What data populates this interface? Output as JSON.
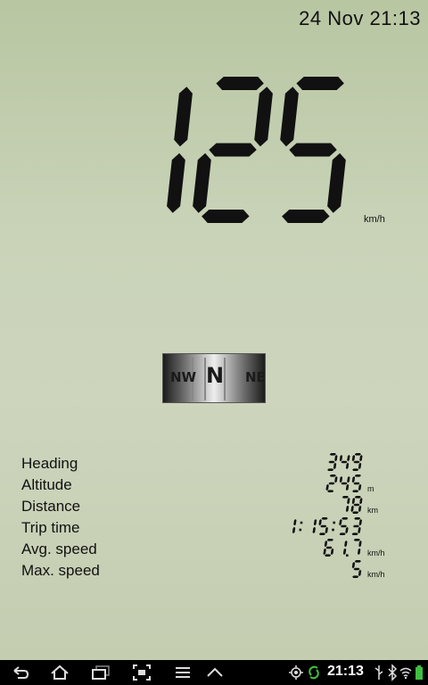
{
  "header": {
    "datetime": "24 Nov 21:13"
  },
  "speedometer": {
    "speed": "125",
    "unit": "km/h"
  },
  "compass": {
    "left": "NW",
    "center": "N",
    "right": "NE"
  },
  "stats": [
    {
      "label": "Heading",
      "value": "349",
      "unit": ""
    },
    {
      "label": "Altitude",
      "value": "245",
      "unit": "m"
    },
    {
      "label": "Distance",
      "value": "78",
      "unit": "km"
    },
    {
      "label": "Trip time",
      "value": "1:15:53",
      "unit": ""
    },
    {
      "label": "Avg. speed",
      "value": "61.7",
      "unit": "km/h"
    },
    {
      "label": "Max. speed",
      "value": "5",
      "unit": "km/h"
    }
  ],
  "navbar": {
    "time": "21:13",
    "icons": [
      "back-icon",
      "home-icon",
      "recent-apps-icon",
      "screenshot-icon",
      "menu-icon",
      "up-chevron-icon",
      "gps-icon",
      "sync-icon",
      "usb-icon",
      "bluetooth-icon",
      "wifi-icon",
      "battery-icon"
    ]
  },
  "colors": {
    "lcd_bg": "#c9d3b8",
    "segment": "#111111",
    "navbar": "#000000"
  }
}
